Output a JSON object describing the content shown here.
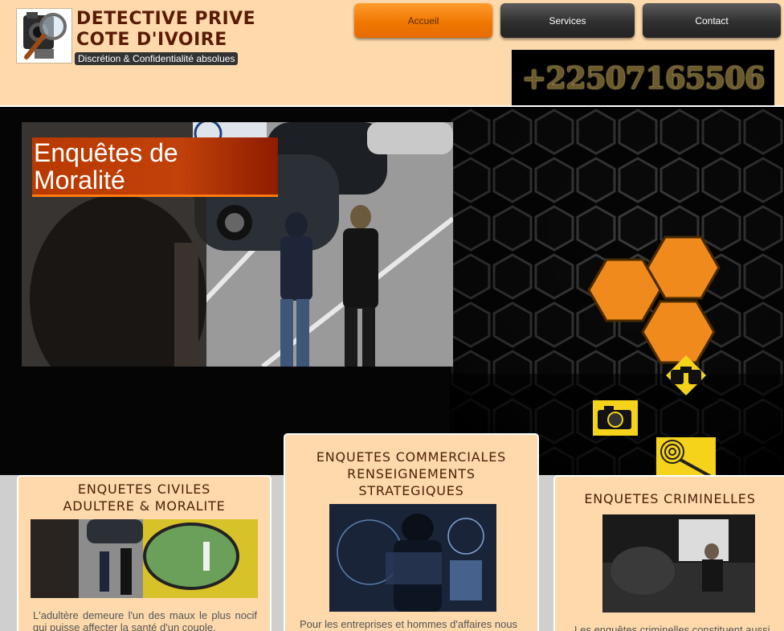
{
  "header": {
    "brand_line1": "DETECTIVE PRIVE",
    "brand_line2": "COTE D'IVOIRE",
    "tagline": "Discrétion & Confidentialité absolues",
    "logo_icon": "detective-magnifier-logo"
  },
  "nav": {
    "home": "Accueil",
    "services": "Services",
    "contact": "Contact"
  },
  "phone": "+22507165506",
  "hero": {
    "title_line1": "Enquêtes de",
    "title_line2": "Moralité",
    "hex_icons": [
      "camera-icon",
      "binoculars-icon",
      "fingerprint-magnifier-icon"
    ]
  },
  "cards": {
    "civil": {
      "title_line1": "ENQUETES CIVILES",
      "title_line2": "ADULTERE & MORALITE",
      "text": "L'adultère demeure l'un des maux le plus nocif qui puisse affecter la santé d'un couple."
    },
    "commercial": {
      "title_line1": "ENQUETES COMMERCIALES",
      "title_line2": "RENSEIGNEMENTS",
      "title_line3": "STRATEGIQUES",
      "text": "Pour les entreprises et hommes d'affaires nous"
    },
    "criminal": {
      "title": "ENQUETES CRIMINELLES",
      "text": "Les enquêtes criminelles constituent aussi"
    }
  },
  "colors": {
    "header_bg": "#fdd9ac",
    "brand": "#5a1b05",
    "accent_orange": "#f07800",
    "nav_dark": "#2f2f2f"
  }
}
